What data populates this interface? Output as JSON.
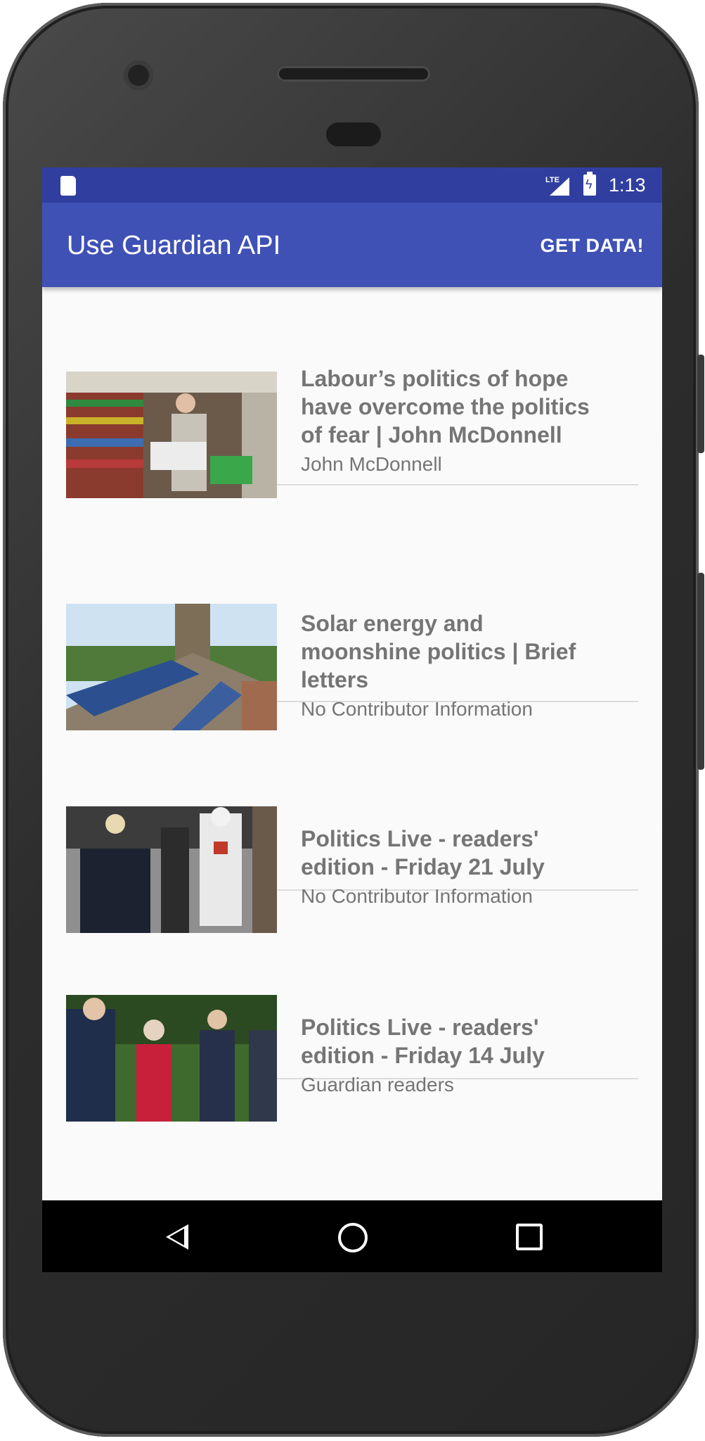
{
  "status_bar": {
    "network": "LTE",
    "time": "1:13"
  },
  "app_bar": {
    "title": "Use Guardian API",
    "action": "GET DATA!"
  },
  "articles": [
    {
      "headline": "Labour’s politics of hope have overcome the politics of fear | John McDonnell",
      "contributor": "John McDonnell"
    },
    {
      "headline": "Solar energy and moonshine politics | Brief letters",
      "contributor": "No Contributor Information"
    },
    {
      "headline": "Politics Live - readers' edition - Friday 21 July",
      "contributor": "No Contributor Information"
    },
    {
      "headline": "Politics Live - readers' edition - Friday 14 July",
      "contributor": "Guardian readers"
    }
  ],
  "colors": {
    "primary": "#3f51b5",
    "primary_dark": "#303f9f",
    "text_secondary": "#757575"
  },
  "icons": [
    "sd-card-icon",
    "signal-icon",
    "battery-charging-icon",
    "back-icon",
    "home-icon",
    "recent-apps-icon"
  ]
}
